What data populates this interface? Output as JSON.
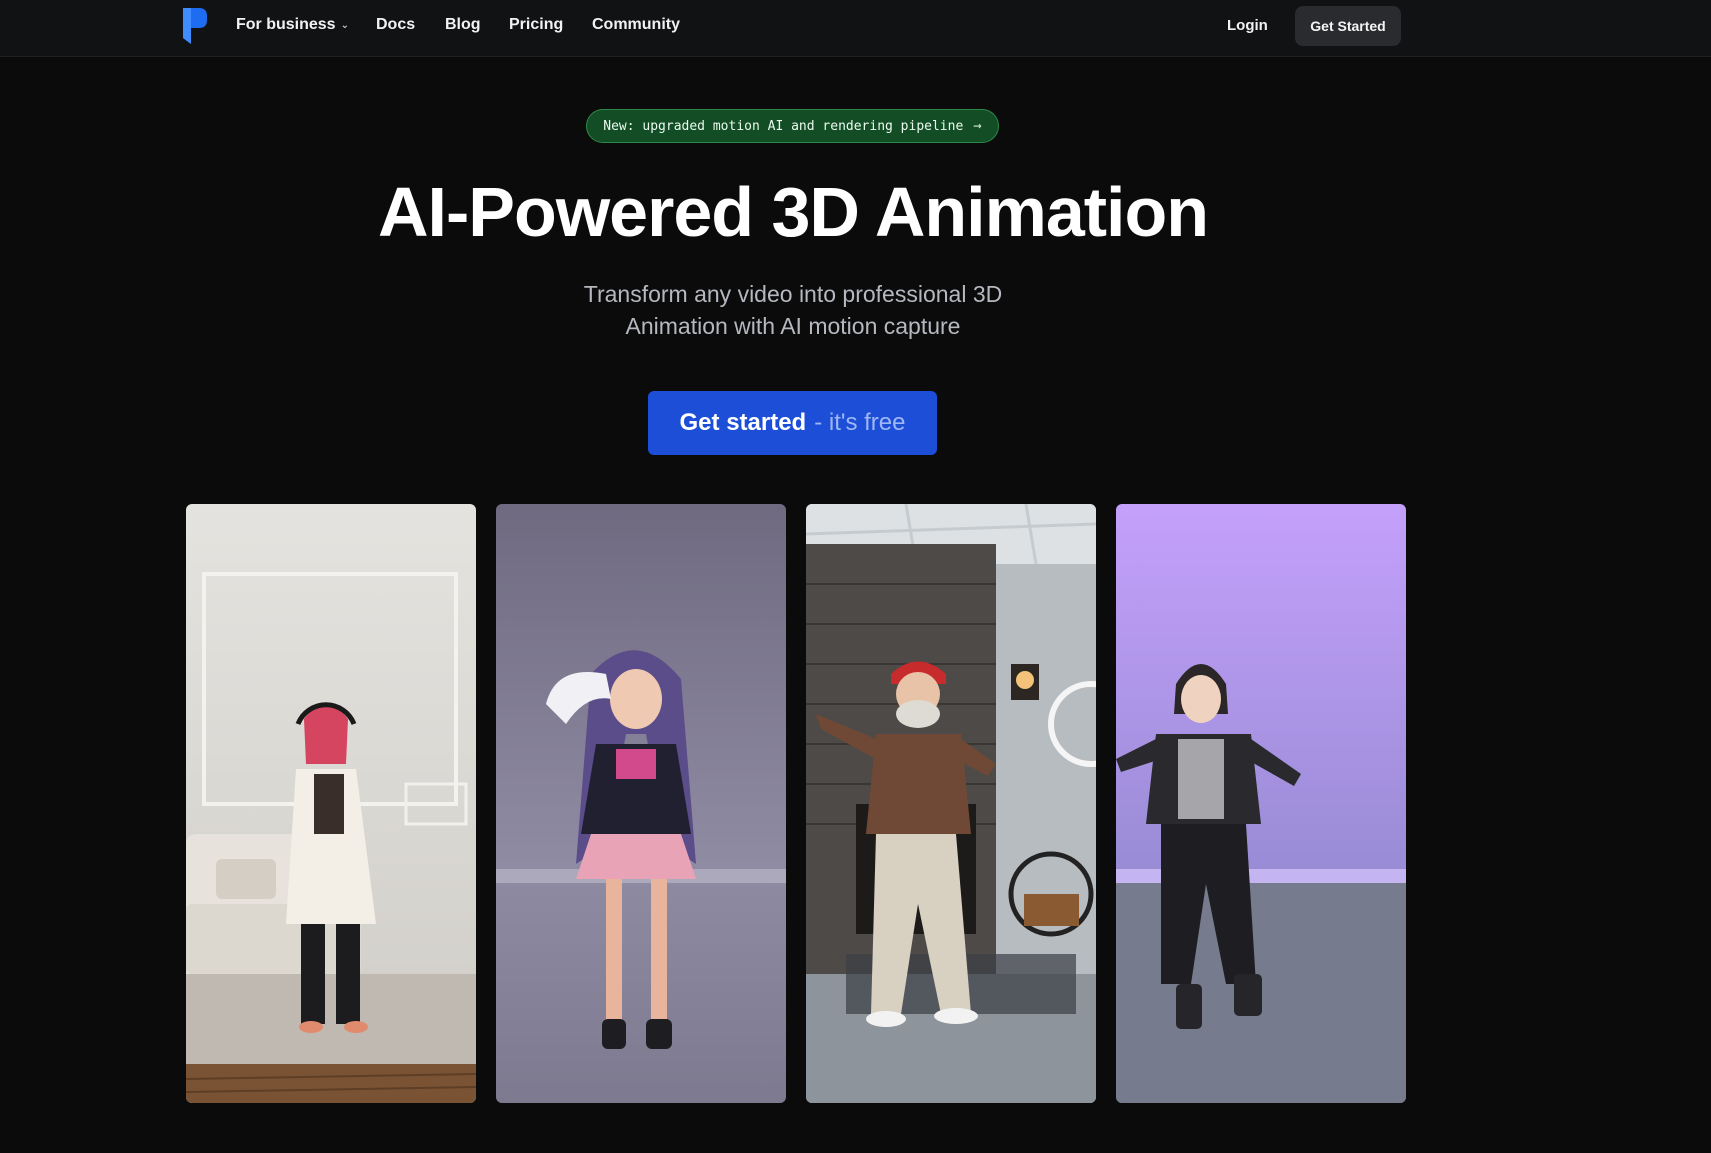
{
  "nav": {
    "items": [
      {
        "label": "For business",
        "has_dropdown": true
      },
      {
        "label": "Docs"
      },
      {
        "label": "Blog"
      },
      {
        "label": "Pricing"
      },
      {
        "label": "Community"
      }
    ],
    "login_label": "Login",
    "get_started_label": "Get Started"
  },
  "hero": {
    "badge_text": "New: upgraded motion AI and rendering pipeline",
    "badge_arrow": "→",
    "title": "AI-Powered 3D Animation",
    "subtitle_line1": "Transform any video into professional 3D",
    "subtitle_line2": "Animation with AI motion capture",
    "cta_strong": "Get started",
    "cta_light": "- it's free"
  },
  "icons": {
    "dropdown": "chevron-down-icon",
    "badge_arrow": "arrow-right-icon",
    "logo": "brand-logo"
  },
  "colors": {
    "background": "#0b0b0c",
    "nav_bg": "#111214",
    "cta_blue": "#1d4ed8",
    "badge_green": "#134d26",
    "badge_border": "#2c8a47"
  }
}
